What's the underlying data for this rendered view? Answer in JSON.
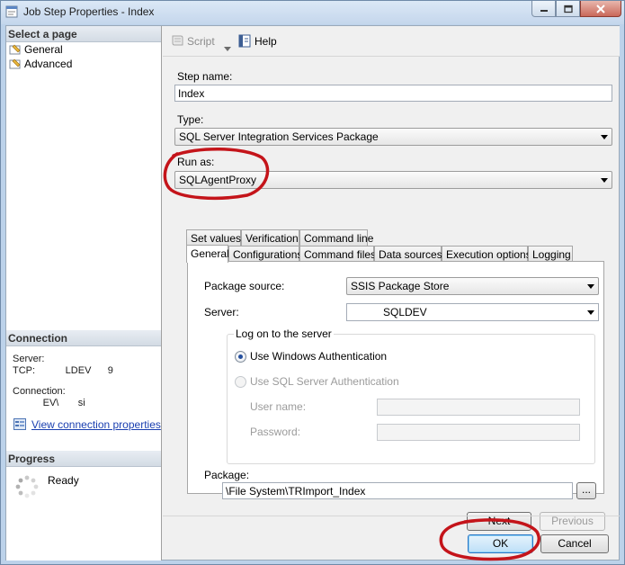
{
  "window": {
    "title": "Job Step Properties - Index"
  },
  "left_pane": {
    "select_page_header": "Select a page",
    "pages": [
      {
        "label": "General",
        "selected": true
      },
      {
        "label": "Advanced",
        "selected": false
      }
    ],
    "connection_header": "Connection",
    "server_label": "Server:",
    "server_value": "TCP:           LDEV      9",
    "connection_label": "Connection:",
    "connection_value": "           EV\\       si",
    "view_connection_link": "View connection properties",
    "progress_header": "Progress",
    "progress_status": "Ready"
  },
  "toolbar": {
    "script_label": "Script",
    "help_label": "Help"
  },
  "form": {
    "step_name_label": "Step name:",
    "step_name_value": "Index",
    "type_label": "Type:",
    "type_value": "SQL Server Integration Services Package",
    "run_as_label": "Run as:",
    "run_as_value": "SQLAgentProxy"
  },
  "tabs": {
    "row_top": [
      "Set values",
      "Verification",
      "Command line"
    ],
    "row_bottom": [
      "General",
      "Configurations",
      "Command files",
      "Data sources",
      "Execution options",
      "Logging"
    ],
    "active": "General"
  },
  "general_tab": {
    "package_source_label": "Package source:",
    "package_source_value": "SSIS Package Store",
    "server_label": "Server:",
    "server_value": "SQLDEV",
    "logon_group_title": "Log on to the server",
    "windows_auth_label": "Use Windows Authentication",
    "sql_auth_label": "Use SQL Server Authentication",
    "user_name_label": "User name:",
    "password_label": "Password:",
    "package_label": "Package:",
    "package_value": "\\File System\\TRImport_Index",
    "browse_label": "..."
  },
  "buttons": {
    "next": "Next",
    "previous": "Previous",
    "ok": "OK",
    "cancel": "Cancel"
  },
  "colors": {
    "annotation": "#c4141a",
    "link": "#1a3fb0",
    "title_bar": "#c4d6ec"
  }
}
